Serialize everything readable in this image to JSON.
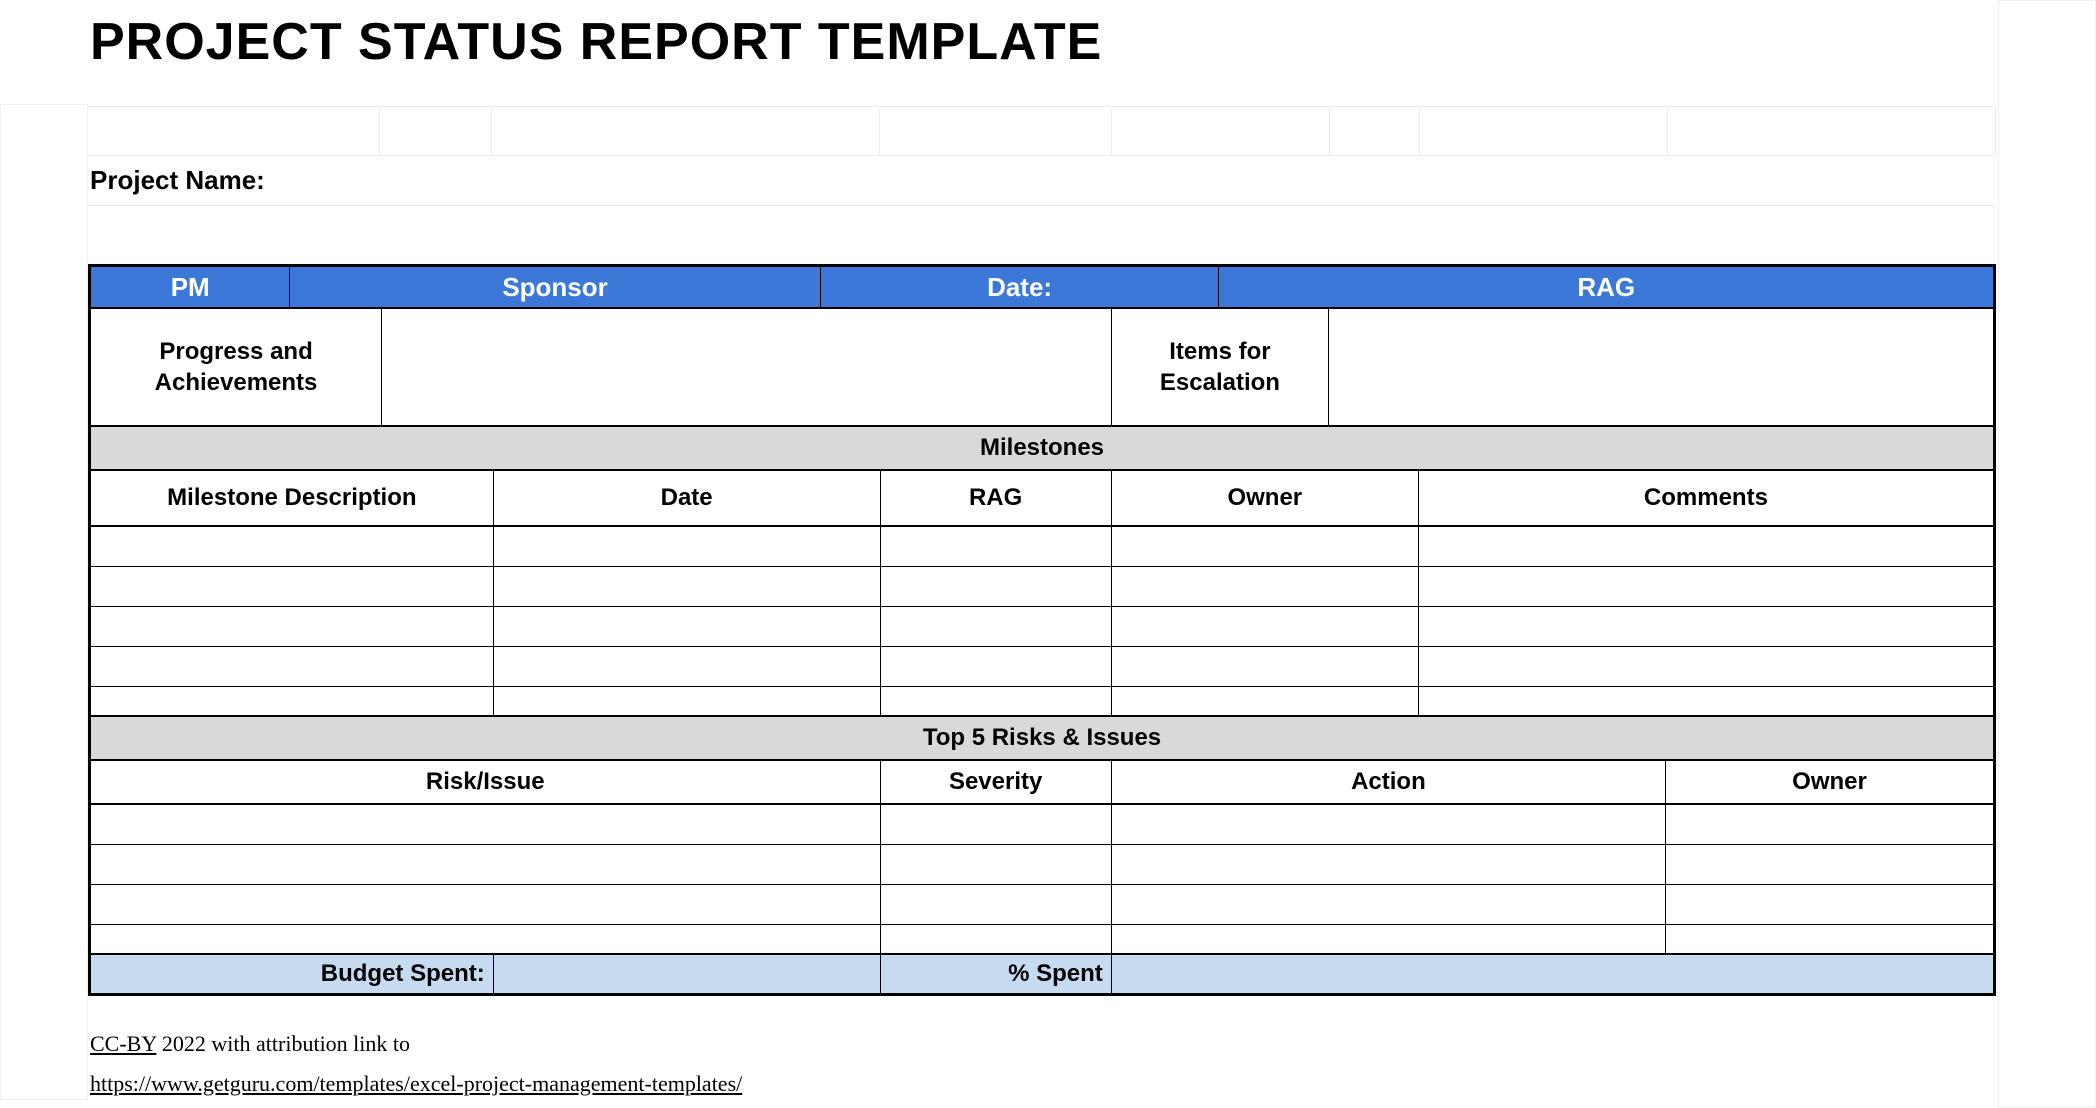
{
  "title": "PROJECT STATUS REPORT TEMPLATE",
  "project_name_label": "Project  Name:",
  "header": {
    "pm": "PM",
    "sponsor": "Sponsor",
    "date": "Date:",
    "rag": "RAG"
  },
  "progress": {
    "progress_label": "Progress and Achievements",
    "escalation_label": "Items for Escalation"
  },
  "milestones": {
    "banner": "Milestones",
    "columns": {
      "description": "Milestone Description",
      "date": "Date",
      "rag": "RAG",
      "owner": "Owner",
      "comments": "Comments"
    },
    "rows": [
      {
        "description": "",
        "date": "",
        "rag": "",
        "owner": "",
        "comments": ""
      },
      {
        "description": "",
        "date": "",
        "rag": "",
        "owner": "",
        "comments": ""
      },
      {
        "description": "",
        "date": "",
        "rag": "",
        "owner": "",
        "comments": ""
      },
      {
        "description": "",
        "date": "",
        "rag": "",
        "owner": "",
        "comments": ""
      },
      {
        "description": "",
        "date": "",
        "rag": "",
        "owner": "",
        "comments": ""
      }
    ]
  },
  "risks": {
    "banner": "Top 5 Risks & Issues",
    "columns": {
      "risk": "Risk/Issue",
      "severity": "Severity",
      "action": "Action",
      "owner": "Owner"
    },
    "rows": [
      {
        "risk": "",
        "severity": "",
        "action": "",
        "owner": ""
      },
      {
        "risk": "",
        "severity": "",
        "action": "",
        "owner": ""
      },
      {
        "risk": "",
        "severity": "",
        "action": "",
        "owner": ""
      },
      {
        "risk": "",
        "severity": "",
        "action": "",
        "owner": ""
      }
    ]
  },
  "budget": {
    "spent_label": "Budget Spent:",
    "spent_value": "",
    "percent_label": "% Spent",
    "percent_value": ""
  },
  "attribution": {
    "license_prefix": "CC-BY",
    "license_rest": " 2022 with attribution link to",
    "url": "https://www.getguru.com/templates/excel-project-management-templates/"
  }
}
